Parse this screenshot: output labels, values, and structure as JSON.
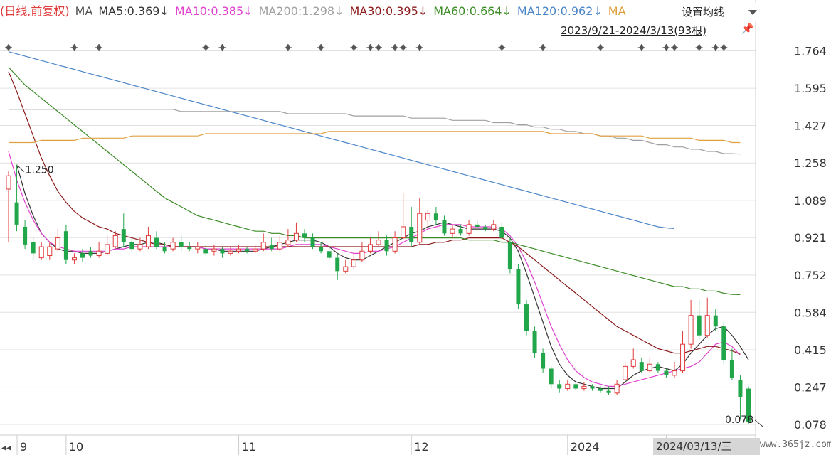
{
  "legend": {
    "mode": "(日线,前复权)",
    "ma": "MA",
    "ma5": "MA5:0.369↓",
    "ma10": "MA10:0.385↓",
    "ma200": "MA200:1.298↓",
    "ma30": "MA30:0.395↓",
    "ma60": "MA60:0.664↓",
    "ma120": "MA120:0.962↓",
    "ma_more": "MA"
  },
  "settings": {
    "label": "设置均线"
  },
  "range": {
    "label": "2023/9/21-2024/3/13(93根)"
  },
  "footer": {
    "date": "2024/03/13/三",
    "watermark": "www.365jz.com"
  },
  "colors": {
    "up": "#e03b3b",
    "down": "#21a64a",
    "ma5": "#333333",
    "ma10": "#e040d0",
    "ma30": "#8b1a1a",
    "ma60": "#3c8c28",
    "ma120": "#4a86c8",
    "ma200": "#a0a0a0",
    "ma250": "#e0a040",
    "grid": "#e2e2e2"
  },
  "chart_data": {
    "type": "candlestick",
    "y_ticks": [
      "1.764",
      "1.595",
      "1.427",
      "1.258",
      "1.089",
      "0.921",
      "0.752",
      "0.584",
      "0.415",
      "0.247",
      "0.078"
    ],
    "ylim": [
      0.03,
      1.82
    ],
    "x_ticks": [
      {
        "label": "9",
        "index": 0
      },
      {
        "label": "10",
        "index": 7
      },
      {
        "label": "11",
        "index": 28
      },
      {
        "label": "12",
        "index": 49
      },
      {
        "label": "2024",
        "index": 68
      },
      {
        "label": "3",
        "index": 80
      }
    ],
    "annotations": [
      {
        "text": "1.250",
        "value": 1.25,
        "index": 1
      },
      {
        "text": "0.078",
        "value": 0.078,
        "index": 92
      }
    ],
    "candles": [
      [
        1.14,
        1.2,
        1.22,
        0.9
      ],
      [
        1.08,
        0.98,
        1.25,
        0.95
      ],
      [
        0.97,
        0.89,
        1.0,
        0.87
      ],
      [
        0.9,
        0.85,
        0.92,
        0.82
      ],
      [
        0.83,
        0.88,
        0.9,
        0.82
      ],
      [
        0.84,
        0.88,
        0.9,
        0.82
      ],
      [
        0.87,
        0.92,
        0.96,
        0.86
      ],
      [
        0.95,
        0.82,
        0.98,
        0.8
      ],
      [
        0.82,
        0.83,
        0.85,
        0.8
      ],
      [
        0.85,
        0.83,
        0.87,
        0.81
      ],
      [
        0.86,
        0.84,
        0.88,
        0.83
      ],
      [
        0.84,
        0.86,
        0.9,
        0.83
      ],
      [
        0.85,
        0.89,
        0.93,
        0.84
      ],
      [
        0.88,
        0.93,
        0.95,
        0.87
      ],
      [
        0.96,
        0.9,
        1.03,
        0.88
      ],
      [
        0.9,
        0.87,
        0.92,
        0.86
      ],
      [
        0.87,
        0.89,
        0.92,
        0.86
      ],
      [
        0.88,
        0.93,
        0.97,
        0.87
      ],
      [
        0.92,
        0.88,
        0.95,
        0.87
      ],
      [
        0.88,
        0.86,
        0.9,
        0.85
      ],
      [
        0.87,
        0.9,
        0.92,
        0.86
      ],
      [
        0.9,
        0.88,
        0.93,
        0.86
      ],
      [
        0.88,
        0.87,
        0.9,
        0.86
      ],
      [
        0.87,
        0.88,
        0.9,
        0.85
      ],
      [
        0.87,
        0.85,
        0.89,
        0.84
      ],
      [
        0.86,
        0.87,
        0.89,
        0.84
      ],
      [
        0.87,
        0.85,
        0.88,
        0.83
      ],
      [
        0.85,
        0.86,
        0.88,
        0.84
      ],
      [
        0.86,
        0.87,
        0.89,
        0.85
      ],
      [
        0.87,
        0.86,
        0.88,
        0.85
      ],
      [
        0.86,
        0.87,
        0.89,
        0.85
      ],
      [
        0.87,
        0.9,
        0.94,
        0.86
      ],
      [
        0.89,
        0.87,
        0.92,
        0.86
      ],
      [
        0.87,
        0.9,
        0.93,
        0.86
      ],
      [
        0.89,
        0.91,
        0.96,
        0.88
      ],
      [
        0.91,
        0.94,
        0.99,
        0.9
      ],
      [
        0.94,
        0.92,
        0.96,
        0.9
      ],
      [
        0.92,
        0.88,
        0.94,
        0.87
      ],
      [
        0.88,
        0.86,
        0.9,
        0.85
      ],
      [
        0.86,
        0.83,
        0.88,
        0.82
      ],
      [
        0.83,
        0.77,
        0.85,
        0.73
      ],
      [
        0.77,
        0.79,
        0.82,
        0.76
      ],
      [
        0.79,
        0.82,
        0.85,
        0.78
      ],
      [
        0.82,
        0.86,
        0.9,
        0.81
      ],
      [
        0.86,
        0.89,
        0.92,
        0.85
      ],
      [
        0.89,
        0.91,
        0.95,
        0.88
      ],
      [
        0.91,
        0.86,
        0.93,
        0.84
      ],
      [
        0.86,
        0.92,
        0.95,
        0.85
      ],
      [
        0.92,
        0.97,
        1.12,
        0.91
      ],
      [
        0.97,
        0.9,
        1.06,
        0.88
      ],
      [
        0.9,
        1.03,
        1.1,
        0.89
      ],
      [
        1.0,
        1.03,
        1.05,
        0.96
      ],
      [
        1.03,
        1.0,
        1.06,
        0.98
      ],
      [
        1.0,
        0.94,
        1.02,
        0.93
      ],
      [
        0.94,
        0.96,
        0.98,
        0.92
      ],
      [
        0.96,
        0.94,
        0.98,
        0.93
      ],
      [
        0.94,
        0.98,
        1.0,
        0.93
      ],
      [
        0.98,
        0.97,
        1.0,
        0.96
      ],
      [
        0.97,
        0.96,
        0.98,
        0.95
      ],
      [
        0.96,
        0.98,
        1.0,
        0.95
      ],
      [
        0.97,
        0.92,
        0.99,
        0.9
      ],
      [
        0.9,
        0.78,
        0.92,
        0.76
      ],
      [
        0.78,
        0.62,
        0.8,
        0.6
      ],
      [
        0.62,
        0.5,
        0.64,
        0.48
      ],
      [
        0.5,
        0.4,
        0.52,
        0.38
      ],
      [
        0.4,
        0.33,
        0.42,
        0.31
      ],
      [
        0.33,
        0.26,
        0.34,
        0.24
      ],
      [
        0.26,
        0.24,
        0.28,
        0.22
      ],
      [
        0.24,
        0.26,
        0.28,
        0.23
      ],
      [
        0.26,
        0.24,
        0.27,
        0.23
      ],
      [
        0.24,
        0.25,
        0.27,
        0.23
      ],
      [
        0.25,
        0.24,
        0.26,
        0.23
      ],
      [
        0.24,
        0.23,
        0.25,
        0.22
      ],
      [
        0.23,
        0.22,
        0.25,
        0.21
      ],
      [
        0.22,
        0.26,
        0.28,
        0.21
      ],
      [
        0.28,
        0.34,
        0.36,
        0.27
      ],
      [
        0.34,
        0.37,
        0.42,
        0.33
      ],
      [
        0.36,
        0.32,
        0.38,
        0.31
      ],
      [
        0.32,
        0.35,
        0.38,
        0.31
      ],
      [
        0.35,
        0.32,
        0.36,
        0.31
      ],
      [
        0.32,
        0.3,
        0.33,
        0.29
      ],
      [
        0.3,
        0.32,
        0.36,
        0.29
      ],
      [
        0.32,
        0.44,
        0.5,
        0.31
      ],
      [
        0.44,
        0.57,
        0.64,
        0.42
      ],
      [
        0.57,
        0.48,
        0.64,
        0.46
      ],
      [
        0.48,
        0.57,
        0.65,
        0.47
      ],
      [
        0.57,
        0.52,
        0.6,
        0.5
      ],
      [
        0.52,
        0.37,
        0.54,
        0.35
      ],
      [
        0.37,
        0.29,
        0.42,
        0.28
      ],
      [
        0.28,
        0.2,
        0.3,
        0.1
      ],
      [
        0.24,
        0.09,
        0.25,
        0.078
      ]
    ],
    "ma_series": [
      {
        "name": "MA5",
        "color": "#333333",
        "x0": 1,
        "points": [
          1.25,
          1.12,
          1.02,
          0.94,
          0.9,
          0.87,
          0.86,
          0.86,
          0.85,
          0.85,
          0.85,
          0.86,
          0.87,
          0.88,
          0.89,
          0.89,
          0.9,
          0.9,
          0.89,
          0.88,
          0.88,
          0.88,
          0.88,
          0.87,
          0.87,
          0.86,
          0.86,
          0.86,
          0.86,
          0.86,
          0.87,
          0.88,
          0.89,
          0.9,
          0.91,
          0.91,
          0.91,
          0.9,
          0.88,
          0.85,
          0.83,
          0.82,
          0.82,
          0.84,
          0.86,
          0.88,
          0.9,
          0.92,
          0.94,
          0.95,
          0.97,
          0.98,
          0.99,
          0.98,
          0.97,
          0.96,
          0.96,
          0.96,
          0.96,
          0.95,
          0.92,
          0.86,
          0.76,
          0.65,
          0.54,
          0.43,
          0.35,
          0.3,
          0.27,
          0.26,
          0.25,
          0.24,
          0.24,
          0.24,
          0.27,
          0.3,
          0.32,
          0.33,
          0.34,
          0.33,
          0.32,
          0.35,
          0.4,
          0.44,
          0.48,
          0.51,
          0.52,
          0.48,
          0.43,
          0.37
        ]
      },
      {
        "name": "MA10",
        "color": "#e040d0",
        "x0": 0,
        "points": [
          1.31,
          1.18,
          1.08,
          1.0,
          0.94,
          0.9,
          0.88,
          0.87,
          0.86,
          0.86,
          0.86,
          0.86,
          0.86,
          0.87,
          0.87,
          0.88,
          0.88,
          0.88,
          0.88,
          0.88,
          0.88,
          0.88,
          0.88,
          0.88,
          0.87,
          0.87,
          0.87,
          0.87,
          0.87,
          0.87,
          0.87,
          0.87,
          0.87,
          0.87,
          0.88,
          0.89,
          0.89,
          0.89,
          0.89,
          0.88,
          0.87,
          0.86,
          0.85,
          0.85,
          0.86,
          0.86,
          0.87,
          0.88,
          0.9,
          0.92,
          0.94,
          0.96,
          0.97,
          0.98,
          0.98,
          0.98,
          0.97,
          0.97,
          0.97,
          0.97,
          0.96,
          0.93,
          0.88,
          0.81,
          0.72,
          0.62,
          0.52,
          0.44,
          0.37,
          0.32,
          0.29,
          0.27,
          0.26,
          0.25,
          0.25,
          0.26,
          0.27,
          0.28,
          0.29,
          0.3,
          0.31,
          0.32,
          0.33,
          0.34,
          0.36,
          0.4,
          0.44,
          0.45,
          0.43,
          0.39
        ]
      },
      {
        "name": "MA30",
        "color": "#8b1a1a",
        "x0": 0,
        "points": [
          1.67,
          1.58,
          1.48,
          1.38,
          1.28,
          1.2,
          1.13,
          1.08,
          1.04,
          1.01,
          0.99,
          0.97,
          0.96,
          0.94,
          0.93,
          0.92,
          0.91,
          0.9,
          0.89,
          0.89,
          0.88,
          0.88,
          0.88,
          0.88,
          0.88,
          0.88,
          0.88,
          0.88,
          0.88,
          0.88,
          0.88,
          0.88,
          0.88,
          0.88,
          0.88,
          0.88,
          0.88,
          0.88,
          0.88,
          0.88,
          0.88,
          0.88,
          0.88,
          0.88,
          0.88,
          0.88,
          0.88,
          0.88,
          0.88,
          0.88,
          0.89,
          0.89,
          0.9,
          0.9,
          0.91,
          0.91,
          0.92,
          0.92,
          0.92,
          0.92,
          0.92,
          0.9,
          0.88,
          0.85,
          0.82,
          0.79,
          0.76,
          0.73,
          0.7,
          0.67,
          0.64,
          0.61,
          0.58,
          0.55,
          0.52,
          0.5,
          0.48,
          0.46,
          0.44,
          0.42,
          0.41,
          0.4,
          0.4,
          0.41,
          0.42,
          0.43,
          0.43,
          0.42,
          0.41,
          0.395
        ]
      },
      {
        "name": "MA60",
        "color": "#3c8c28",
        "x0": 0,
        "points": [
          1.69,
          1.65,
          1.61,
          1.58,
          1.55,
          1.52,
          1.49,
          1.46,
          1.43,
          1.4,
          1.37,
          1.34,
          1.31,
          1.28,
          1.25,
          1.22,
          1.19,
          1.16,
          1.13,
          1.1,
          1.08,
          1.06,
          1.04,
          1.02,
          1.01,
          1.0,
          0.99,
          0.98,
          0.97,
          0.96,
          0.95,
          0.95,
          0.94,
          0.94,
          0.93,
          0.93,
          0.92,
          0.92,
          0.92,
          0.92,
          0.92,
          0.92,
          0.92,
          0.92,
          0.92,
          0.92,
          0.92,
          0.92,
          0.92,
          0.92,
          0.92,
          0.92,
          0.92,
          0.92,
          0.92,
          0.92,
          0.91,
          0.91,
          0.91,
          0.91,
          0.9,
          0.9,
          0.89,
          0.88,
          0.87,
          0.86,
          0.85,
          0.84,
          0.83,
          0.82,
          0.81,
          0.8,
          0.79,
          0.78,
          0.77,
          0.76,
          0.75,
          0.74,
          0.73,
          0.72,
          0.71,
          0.7,
          0.7,
          0.69,
          0.69,
          0.68,
          0.68,
          0.67,
          0.665,
          0.664
        ]
      },
      {
        "name": "MA120",
        "color": "#4a86c8",
        "x0": 0,
        "points": [
          1.76,
          1.75,
          1.74,
          1.73,
          1.72,
          1.71,
          1.7,
          1.69,
          1.68,
          1.67,
          1.66,
          1.65,
          1.64,
          1.63,
          1.62,
          1.61,
          1.6,
          1.59,
          1.58,
          1.57,
          1.56,
          1.55,
          1.54,
          1.53,
          1.52,
          1.51,
          1.5,
          1.49,
          1.48,
          1.47,
          1.46,
          1.45,
          1.44,
          1.43,
          1.42,
          1.41,
          1.4,
          1.39,
          1.38,
          1.37,
          1.36,
          1.35,
          1.34,
          1.33,
          1.32,
          1.31,
          1.3,
          1.29,
          1.28,
          1.27,
          1.26,
          1.25,
          1.24,
          1.23,
          1.22,
          1.21,
          1.2,
          1.19,
          1.18,
          1.17,
          1.16,
          1.15,
          1.14,
          1.13,
          1.12,
          1.11,
          1.1,
          1.09,
          1.08,
          1.07,
          1.06,
          1.05,
          1.04,
          1.03,
          1.02,
          1.01,
          1.0,
          0.99,
          0.98,
          0.97,
          0.965,
          0.962
        ]
      },
      {
        "name": "MA200",
        "color": "#a0a0a0",
        "x0": 0,
        "points": [
          1.5,
          1.5,
          1.5,
          1.5,
          1.5,
          1.5,
          1.5,
          1.5,
          1.5,
          1.5,
          1.5,
          1.5,
          1.5,
          1.5,
          1.5,
          1.5,
          1.5,
          1.5,
          1.5,
          1.5,
          1.5,
          1.49,
          1.49,
          1.49,
          1.49,
          1.49,
          1.49,
          1.49,
          1.49,
          1.49,
          1.49,
          1.49,
          1.49,
          1.49,
          1.48,
          1.48,
          1.48,
          1.48,
          1.48,
          1.48,
          1.48,
          1.48,
          1.47,
          1.47,
          1.47,
          1.47,
          1.47,
          1.47,
          1.47,
          1.46,
          1.46,
          1.46,
          1.46,
          1.46,
          1.45,
          1.45,
          1.45,
          1.45,
          1.45,
          1.44,
          1.44,
          1.44,
          1.43,
          1.43,
          1.42,
          1.42,
          1.41,
          1.41,
          1.4,
          1.4,
          1.39,
          1.39,
          1.38,
          1.38,
          1.37,
          1.37,
          1.36,
          1.36,
          1.35,
          1.34,
          1.34,
          1.33,
          1.33,
          1.32,
          1.32,
          1.31,
          1.31,
          1.3,
          1.3,
          1.298
        ]
      },
      {
        "name": "MA250",
        "color": "#e0a040",
        "x0": 0,
        "points": [
          1.35,
          1.35,
          1.35,
          1.35,
          1.36,
          1.36,
          1.36,
          1.36,
          1.36,
          1.37,
          1.37,
          1.37,
          1.37,
          1.37,
          1.37,
          1.38,
          1.38,
          1.38,
          1.38,
          1.38,
          1.38,
          1.38,
          1.38,
          1.38,
          1.39,
          1.39,
          1.39,
          1.39,
          1.39,
          1.39,
          1.39,
          1.39,
          1.39,
          1.39,
          1.39,
          1.39,
          1.39,
          1.39,
          1.39,
          1.4,
          1.4,
          1.4,
          1.4,
          1.4,
          1.4,
          1.4,
          1.4,
          1.4,
          1.4,
          1.4,
          1.4,
          1.4,
          1.4,
          1.4,
          1.4,
          1.4,
          1.4,
          1.4,
          1.4,
          1.4,
          1.4,
          1.4,
          1.4,
          1.4,
          1.4,
          1.4,
          1.39,
          1.39,
          1.39,
          1.39,
          1.39,
          1.39,
          1.38,
          1.38,
          1.38,
          1.38,
          1.38,
          1.38,
          1.37,
          1.37,
          1.37,
          1.37,
          1.37,
          1.37,
          1.36,
          1.36,
          1.36,
          1.36,
          1.35,
          1.35
        ]
      }
    ],
    "markers": [
      0,
      8,
      11,
      24,
      26,
      34,
      38,
      42,
      44,
      45,
      47,
      48,
      50,
      60,
      65,
      72,
      77,
      80,
      81,
      84,
      86,
      87
    ]
  }
}
